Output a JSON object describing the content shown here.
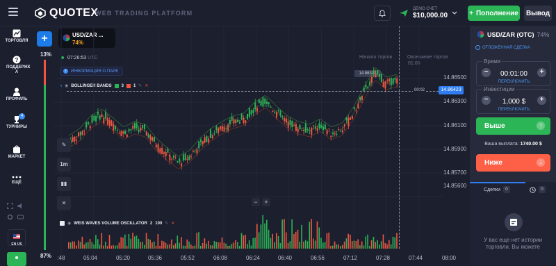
{
  "header": {
    "logo_text": "QUOTEX",
    "subtitle": "WEB TRADING PLATFORM",
    "account_label": "ДЕМО СЧЕТ",
    "account_balance": "$10,000.00",
    "deposit_label": "Пополнение",
    "withdraw_label": "Вывод"
  },
  "sidebar": {
    "items": [
      {
        "label": "ТОРГОВЛЯ",
        "icon": "chart-icon"
      },
      {
        "label": "ПОДДЕРЖК А",
        "icon": "help-icon"
      },
      {
        "label": "ПРОФИЛЬ",
        "icon": "user-icon"
      },
      {
        "label": "ТУРНИРЫ",
        "icon": "trophy-icon",
        "badge": "4"
      },
      {
        "label": "МАРКЕТ",
        "icon": "shop-icon"
      },
      {
        "label": "ЕЩЁ",
        "icon": "more-icon"
      }
    ],
    "lang": "EN US"
  },
  "chart_area": {
    "asset_tab": {
      "name": "USD/ZAR ...",
      "payout": "74%"
    },
    "clock": "07:26:53",
    "timezone": "UTC",
    "info_label": "ИНФОРМАЦИЯ О ПАРЕ",
    "indicator_main": {
      "name": "BOLLINGER BANDS",
      "count_green": "3",
      "count_red": "1"
    },
    "indicator_sub": {
      "name": "WEIS WAVES VOLUME OSCILLATOR",
      "p1": "2",
      "p2": "100"
    },
    "timeframe": "1m",
    "sentiment_up": "13%",
    "sentiment_down": "87%",
    "start_label": "Начало торгов",
    "end_label": "Окончание торгов",
    "end_time": "01:00",
    "current_price": "14.86423",
    "hover_price": "14.86323",
    "countdown": "00:02",
    "y_ticks": [
      "14.86500",
      "14.86300",
      "14.86100",
      "14.85900",
      "14.85700",
      "14.85600"
    ],
    "x_ticks": [
      ":48",
      "05:04",
      "05:20",
      "05:36",
      "05:52",
      "06:08",
      "06:24",
      "06:40",
      "06:56",
      "07:12",
      "07:28",
      "07:44",
      "08:00"
    ]
  },
  "panel": {
    "asset": "USD/ZAR (OTC)",
    "payout": "74%",
    "pending_label": "ОТЛОЖЕННАЯ СДЕЛКА",
    "time_label": "Время",
    "time_value": "00:01:00",
    "switch_label": "ПЕРЕКЛЮЧИТЬ",
    "investment_label": "Инвестиции",
    "investment_value": "1,000 $",
    "up_label": "Выше",
    "down_label": "Ниже",
    "payout_label": "Ваша выплата:",
    "payout_value": "1740.00 $",
    "trades_tab": "Сделки",
    "trades_count": "0",
    "history_count": "0",
    "empty_text": "У вас еще нет истории торговли. Вы можете"
  },
  "colors": {
    "bull": "#2bb557",
    "bear": "#f2553f",
    "accent": "#1d7ce8"
  },
  "chart_data": {
    "type": "candlestick",
    "x_axis": [
      ":48",
      "05:04",
      "05:20",
      "05:36",
      "05:52",
      "06:08",
      "06:24",
      "06:40",
      "06:56",
      "07:12",
      "07:28",
      "07:44",
      "08:00"
    ],
    "price_path": [
      14.8598,
      14.8603,
      14.8612,
      14.8617,
      14.8611,
      14.8604,
      14.8608,
      14.8606,
      14.8596,
      14.8589,
      14.8583,
      14.8587,
      14.8596,
      14.8603,
      14.8608,
      14.8612,
      14.8614,
      14.8622,
      14.8627,
      14.8619,
      14.8612,
      14.8608,
      14.8606,
      14.861,
      14.8604,
      14.8607,
      14.8618,
      14.8633,
      14.8647,
      14.864,
      14.8642
    ],
    "y_range": [
      14.8555,
      14.8655
    ],
    "current_price": 14.86423
  }
}
